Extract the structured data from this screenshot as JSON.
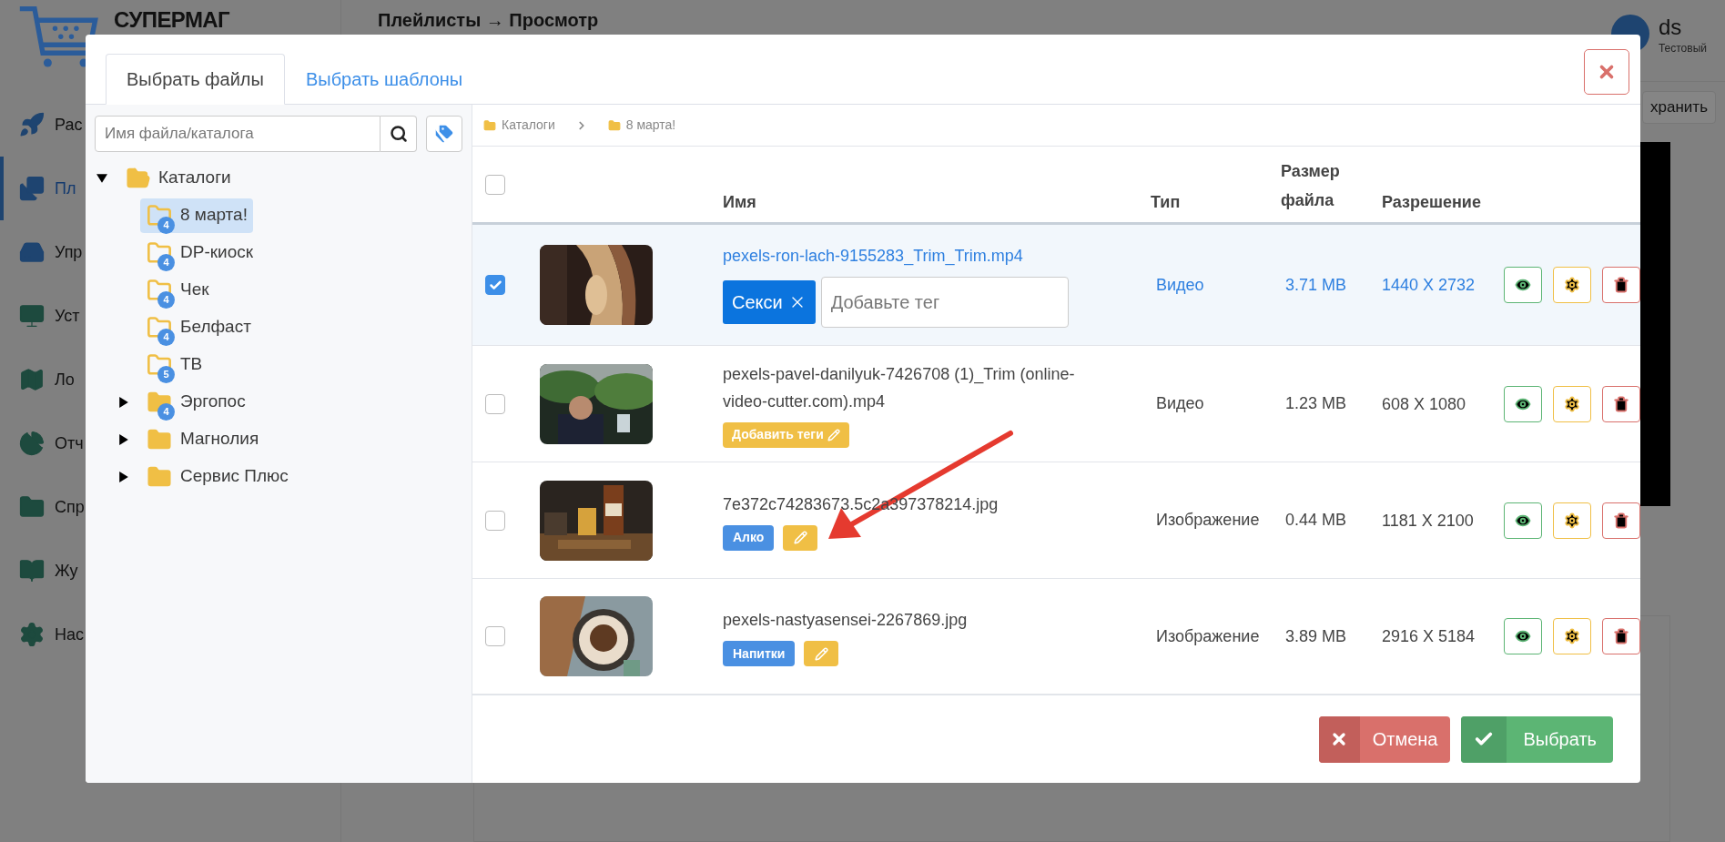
{
  "app": {
    "logo": "СУПЕРМАГ",
    "header_title": "Плейлисты → Просмотр",
    "user": {
      "name": "ds",
      "role": "Тестовый"
    },
    "save_button": "хранить",
    "nav": [
      {
        "label": "Рас",
        "selected": false
      },
      {
        "label": "Пл",
        "selected": true
      },
      {
        "label": "Упр",
        "selected": false
      },
      {
        "label": "Уст",
        "selected": false
      },
      {
        "label": "Ло",
        "selected": false
      },
      {
        "label": "Отч",
        "selected": false
      },
      {
        "label": "Спр",
        "selected": false
      },
      {
        "label": "Жу",
        "selected": false
      },
      {
        "label": "Нас",
        "selected": false
      }
    ]
  },
  "dialog": {
    "tabs": [
      {
        "label": "Выбрать файлы",
        "selected": true
      },
      {
        "label": "Выбрать шаблоны",
        "selected": false
      }
    ],
    "search": {
      "placeholder": "Имя файла/каталога"
    },
    "tree": [
      {
        "label": "Каталоги",
        "expanded": true,
        "selected": false,
        "children": [
          {
            "label": "8 марта!",
            "count": "4",
            "selected": true
          },
          {
            "label": "DP-киоск",
            "count": "4",
            "selected": false
          },
          {
            "label": "Чек",
            "count": "4",
            "selected": false
          },
          {
            "label": "Белфаст",
            "count": "4",
            "selected": false
          },
          {
            "label": "ТВ",
            "count": "5",
            "selected": false
          },
          {
            "label": "Эргопос",
            "count": "4",
            "expanded": false,
            "selected": false
          },
          {
            "label": "Магнолия",
            "expanded": false,
            "selected": false
          },
          {
            "label": "Сервис Плюс",
            "expanded": false,
            "selected": false
          }
        ]
      }
    ],
    "breadcrumb": [
      "Каталоги",
      "8 марта!"
    ],
    "select_all": {
      "checked": false
    },
    "columns": [
      "Имя",
      "Тип",
      "Размер файла",
      "Разрешение"
    ],
    "rows": [
      {
        "selected": true,
        "name": "pexels-ron-lach-9155283_Trim_Trim.mp4",
        "kind": "editing",
        "tags": [
          {
            "label": "Секси"
          }
        ],
        "tag_input": {
          "placeholder": "Добавьте тег"
        },
        "type": "Видео",
        "size": "3.71 MB",
        "resolution": "1440 X 2732"
      },
      {
        "selected": false,
        "name": "pexels-pavel-danilyuk-7426708 (1)_Trim (online-video-cutter.com).mp4",
        "kind": "empty",
        "add_tags": "Добавить теги",
        "type": "Видео",
        "size": "1.23 MB",
        "resolution": "608 X 1080"
      },
      {
        "selected": false,
        "name": "7e372c74283673.5c2a397378214.jpg",
        "kind": "tagged",
        "tags": [
          {
            "label": "Алко"
          }
        ],
        "type": "Изображение",
        "size": "0.44 MB",
        "resolution": "1181 X 2100"
      },
      {
        "selected": false,
        "name": "pexels-nastyasensei-2267869.jpg",
        "kind": "tagged",
        "tags": [
          {
            "label": "Напитки"
          }
        ],
        "type": "Изображение",
        "size": "3.89 MB",
        "resolution": "2916 X 5184"
      }
    ],
    "buttons": {
      "cancel": "Отмена",
      "select": "Выбрать"
    }
  }
}
